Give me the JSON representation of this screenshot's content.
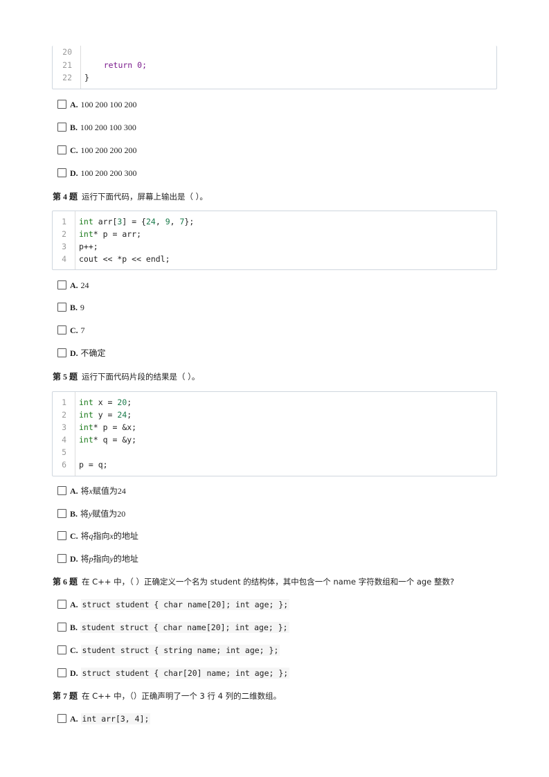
{
  "code_top": {
    "lines": [
      {
        "n": "20",
        "text": ""
      },
      {
        "n": "21",
        "text": "    return 0;"
      },
      {
        "n": "22",
        "text": "}"
      }
    ]
  },
  "q3_options": [
    {
      "label": "A.",
      "text": "100 200 100 200"
    },
    {
      "label": "B.",
      "text": "100 200 100 300"
    },
    {
      "label": "C.",
      "text": "100 200 200 200"
    },
    {
      "label": "D.",
      "text": "100 200 200 300"
    }
  ],
  "q4": {
    "number": "第 4 题",
    "text": "运行下面代码，屏幕上输出是（ ）。",
    "code": [
      {
        "n": "1",
        "text": "int arr[3] = {24, 9, 7};"
      },
      {
        "n": "2",
        "text": "int* p = arr;"
      },
      {
        "n": "3",
        "text": "p++;"
      },
      {
        "n": "4",
        "text": "cout << *p << endl;"
      }
    ],
    "options": [
      {
        "label": "A.",
        "text": "24"
      },
      {
        "label": "B.",
        "text": "9"
      },
      {
        "label": "C.",
        "text": "7"
      },
      {
        "label": "D.",
        "text": "不确定"
      }
    ]
  },
  "q5": {
    "number": "第 5 题",
    "text": "运行下面代码片段的结果是（ ）。",
    "code": [
      {
        "n": "1",
        "text": "int x = 20;"
      },
      {
        "n": "2",
        "text": "int y = 24;"
      },
      {
        "n": "3",
        "text": "int* p = &x;"
      },
      {
        "n": "4",
        "text": "int* q = &y;"
      },
      {
        "n": "5",
        "text": ""
      },
      {
        "n": "6",
        "text": "p = q;"
      }
    ],
    "options": [
      {
        "label": "A.",
        "pre": "将",
        "var": "x",
        "post": "赋值为24"
      },
      {
        "label": "B.",
        "pre": "将",
        "var": "y",
        "post": "赋值为20"
      },
      {
        "label": "C.",
        "pre": "将",
        "var": "q",
        "mid": "指向",
        "var2": "x",
        "post": "的地址"
      },
      {
        "label": "D.",
        "pre": "将",
        "var": "p",
        "mid": "指向",
        "var2": "y",
        "post": "的地址"
      }
    ]
  },
  "q6": {
    "number": "第 6 题",
    "text": "在 C++ 中，（ ）正确定义一个名为 student 的结构体，其中包含一个 name 字符数组和一个 age 整数?",
    "options": [
      {
        "label": "A.",
        "code": "struct student { char name[20]; int age; };"
      },
      {
        "label": "B.",
        "code": "student struct { char name[20]; int age; };"
      },
      {
        "label": "C.",
        "code": "student struct { string name; int age; };"
      },
      {
        "label": "D.",
        "code": "struct student { char[20] name; int age; };"
      }
    ]
  },
  "q7": {
    "number": "第 7 题",
    "text": "在 C++ 中，（）正确声明了一个 3 行 4 列的二维数组。",
    "options": [
      {
        "label": "A.",
        "code": "int arr[3, 4];"
      }
    ]
  }
}
